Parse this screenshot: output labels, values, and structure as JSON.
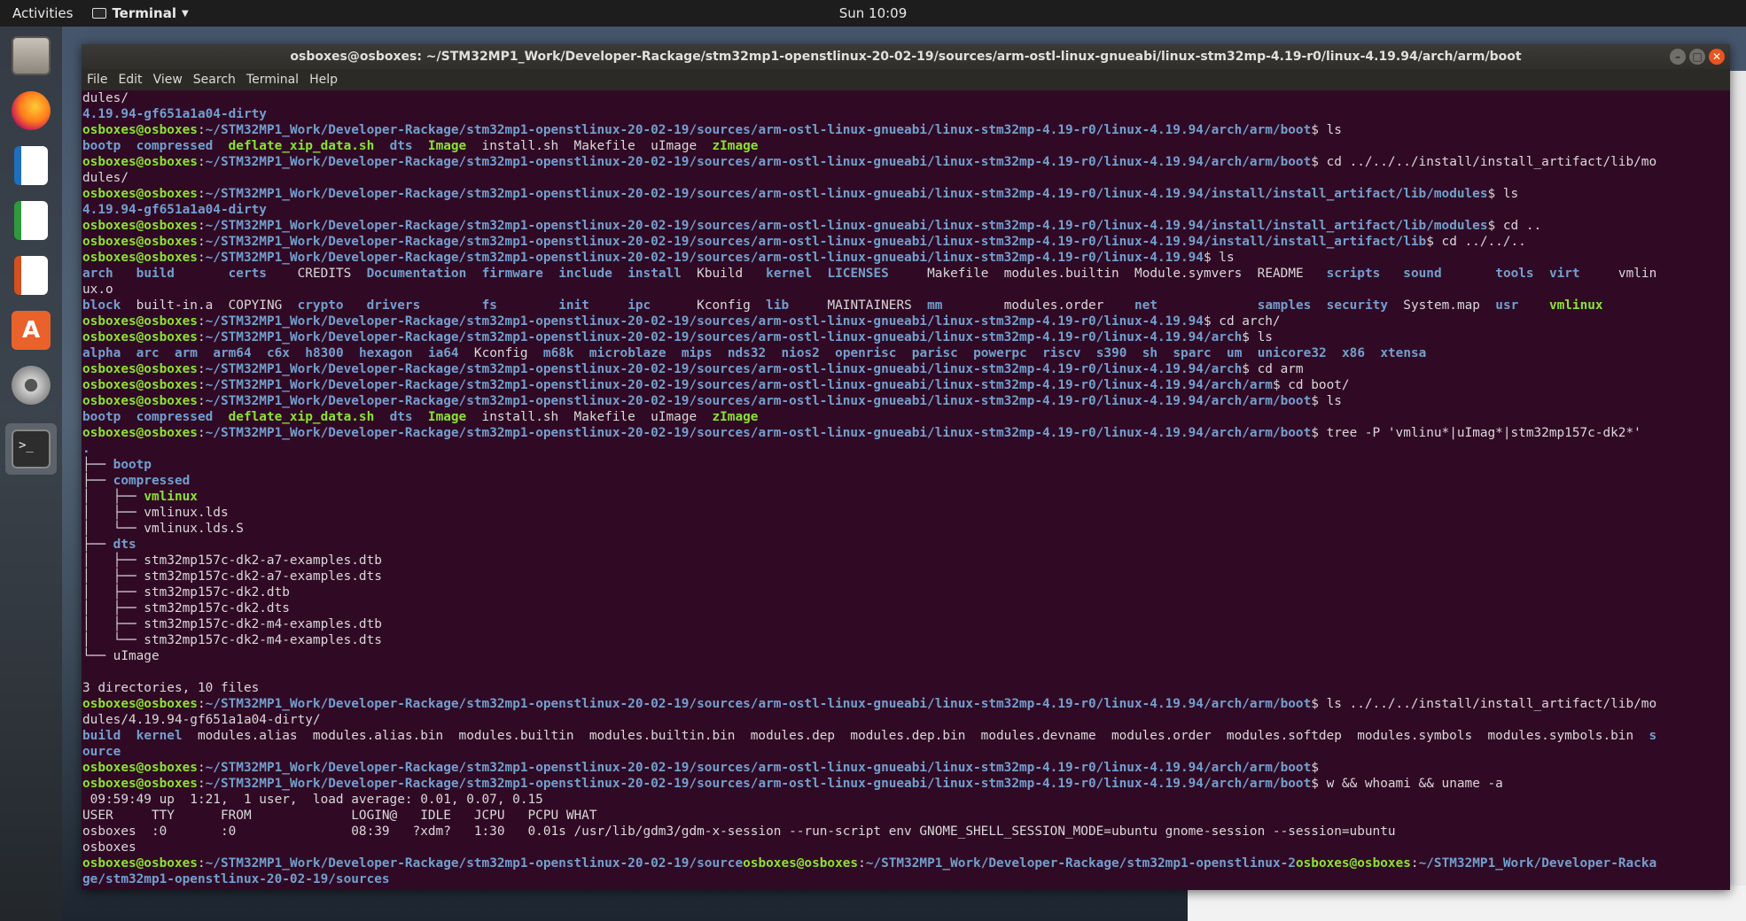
{
  "topbar": {
    "activities": "Activities",
    "app_name": "Terminal",
    "clock": "Sun 10:09"
  },
  "dock": {
    "items": [
      "files-icon",
      "firefox-icon",
      "writer-icon",
      "calc-icon",
      "impress-icon",
      "software-icon",
      "settings-icon",
      "terminal-icon"
    ]
  },
  "window": {
    "title": "osboxes@osboxes: ~/STM32MP1_Work/Developer-Rackage/stm32mp1-openstlinux-20-02-19/sources/arm-ostl-linux-gnueabi/linux-stm32mp-4.19-r0/linux-4.19.94/arch/arm/boot",
    "menu": [
      "File",
      "Edit",
      "View",
      "Search",
      "Terminal",
      "Help"
    ]
  },
  "terminal": {
    "lines": [
      [
        [
          "n",
          "dules/"
        ]
      ],
      [
        [
          "p",
          "4.19.94-gf651a1a04-dirty"
        ]
      ],
      [
        [
          "u",
          "osboxes@osboxes"
        ],
        [
          "n",
          ":"
        ],
        [
          "p",
          "~/STM32MP1_Work/Developer-Rackage/stm32mp1-openstlinux-20-02-19/sources/arm-ostl-linux-gnueabi/linux-stm32mp-4.19-r0/linux-4.19.94/arch/arm/boot"
        ],
        [
          "n",
          "$ ls"
        ]
      ],
      [
        [
          "d",
          "bootp"
        ],
        [
          "n",
          "  "
        ],
        [
          "d",
          "compressed"
        ],
        [
          "n",
          "  "
        ],
        [
          "x",
          "deflate_xip_data.sh"
        ],
        [
          "n",
          "  "
        ],
        [
          "d",
          "dts"
        ],
        [
          "n",
          "  "
        ],
        [
          "x",
          "Image"
        ],
        [
          "n",
          "  install.sh  Makefile  uImage  "
        ],
        [
          "x",
          "zImage"
        ]
      ],
      [
        [
          "u",
          "osboxes@osboxes"
        ],
        [
          "n",
          ":"
        ],
        [
          "p",
          "~/STM32MP1_Work/Developer-Rackage/stm32mp1-openstlinux-20-02-19/sources/arm-ostl-linux-gnueabi/linux-stm32mp-4.19-r0/linux-4.19.94/arch/arm/boot"
        ],
        [
          "n",
          "$ cd ../../../install/install_artifact/lib/mo"
        ]
      ],
      [
        [
          "n",
          "dules/"
        ]
      ],
      [
        [
          "u",
          "osboxes@osboxes"
        ],
        [
          "n",
          ":"
        ],
        [
          "p",
          "~/STM32MP1_Work/Developer-Rackage/stm32mp1-openstlinux-20-02-19/sources/arm-ostl-linux-gnueabi/linux-stm32mp-4.19-r0/linux-4.19.94/install/install_artifact/lib/modules"
        ],
        [
          "n",
          "$ ls"
        ]
      ],
      [
        [
          "p",
          "4.19.94-gf651a1a04-dirty"
        ]
      ],
      [
        [
          "u",
          "osboxes@osboxes"
        ],
        [
          "n",
          ":"
        ],
        [
          "p",
          "~/STM32MP1_Work/Developer-Rackage/stm32mp1-openstlinux-20-02-19/sources/arm-ostl-linux-gnueabi/linux-stm32mp-4.19-r0/linux-4.19.94/install/install_artifact/lib/modules"
        ],
        [
          "n",
          "$ cd .."
        ]
      ],
      [
        [
          "u",
          "osboxes@osboxes"
        ],
        [
          "n",
          ":"
        ],
        [
          "p",
          "~/STM32MP1_Work/Developer-Rackage/stm32mp1-openstlinux-20-02-19/sources/arm-ostl-linux-gnueabi/linux-stm32mp-4.19-r0/linux-4.19.94/install/install_artifact/lib"
        ],
        [
          "n",
          "$ cd ../../.."
        ]
      ],
      [
        [
          "u",
          "osboxes@osboxes"
        ],
        [
          "n",
          ":"
        ],
        [
          "p",
          "~/STM32MP1_Work/Developer-Rackage/stm32mp1-openstlinux-20-02-19/sources/arm-ostl-linux-gnueabi/linux-stm32mp-4.19-r0/linux-4.19.94"
        ],
        [
          "n",
          "$ ls"
        ]
      ],
      [
        [
          "d",
          "arch"
        ],
        [
          "n",
          "   "
        ],
        [
          "d",
          "build"
        ],
        [
          "n",
          "       "
        ],
        [
          "d",
          "certs"
        ],
        [
          "n",
          "    CREDITS  "
        ],
        [
          "d",
          "Documentation"
        ],
        [
          "n",
          "  "
        ],
        [
          "d",
          "firmware"
        ],
        [
          "n",
          "  "
        ],
        [
          "d",
          "include"
        ],
        [
          "n",
          "  "
        ],
        [
          "d",
          "install"
        ],
        [
          "n",
          "  Kbuild   "
        ],
        [
          "d",
          "kernel"
        ],
        [
          "n",
          "  "
        ],
        [
          "d",
          "LICENSES"
        ],
        [
          "n",
          "     Makefile  modules.builtin  Module.symvers  README   "
        ],
        [
          "d",
          "scripts"
        ],
        [
          "n",
          "   "
        ],
        [
          "d",
          "sound"
        ],
        [
          "n",
          "       "
        ],
        [
          "d",
          "tools"
        ],
        [
          "n",
          "  "
        ],
        [
          "d",
          "virt"
        ],
        [
          "n",
          "     vmlin"
        ]
      ],
      [
        [
          "n",
          "ux.o"
        ]
      ],
      [
        [
          "d",
          "block"
        ],
        [
          "n",
          "  built-in.a  COPYING  "
        ],
        [
          "d",
          "crypto"
        ],
        [
          "n",
          "   "
        ],
        [
          "d",
          "drivers"
        ],
        [
          "n",
          "        "
        ],
        [
          "d",
          "fs"
        ],
        [
          "n",
          "        "
        ],
        [
          "d",
          "init"
        ],
        [
          "n",
          "     "
        ],
        [
          "d",
          "ipc"
        ],
        [
          "n",
          "      Kconfig  "
        ],
        [
          "d",
          "lib"
        ],
        [
          "n",
          "     MAINTAINERS  "
        ],
        [
          "d",
          "mm"
        ],
        [
          "n",
          "        modules.order    "
        ],
        [
          "d",
          "net"
        ],
        [
          "n",
          "             "
        ],
        [
          "d",
          "samples"
        ],
        [
          "n",
          "  "
        ],
        [
          "d",
          "security"
        ],
        [
          "n",
          "  System.map  "
        ],
        [
          "d",
          "usr"
        ],
        [
          "n",
          "    "
        ],
        [
          "x",
          "vmlinux"
        ]
      ],
      [
        [
          "u",
          "osboxes@osboxes"
        ],
        [
          "n",
          ":"
        ],
        [
          "p",
          "~/STM32MP1_Work/Developer-Rackage/stm32mp1-openstlinux-20-02-19/sources/arm-ostl-linux-gnueabi/linux-stm32mp-4.19-r0/linux-4.19.94"
        ],
        [
          "n",
          "$ cd arch/"
        ]
      ],
      [
        [
          "u",
          "osboxes@osboxes"
        ],
        [
          "n",
          ":"
        ],
        [
          "p",
          "~/STM32MP1_Work/Developer-Rackage/stm32mp1-openstlinux-20-02-19/sources/arm-ostl-linux-gnueabi/linux-stm32mp-4.19-r0/linux-4.19.94/arch"
        ],
        [
          "n",
          "$ ls"
        ]
      ],
      [
        [
          "d",
          "alpha"
        ],
        [
          "n",
          "  "
        ],
        [
          "d",
          "arc"
        ],
        [
          "n",
          "  "
        ],
        [
          "d",
          "arm"
        ],
        [
          "n",
          "  "
        ],
        [
          "d",
          "arm64"
        ],
        [
          "n",
          "  "
        ],
        [
          "d",
          "c6x"
        ],
        [
          "n",
          "  "
        ],
        [
          "d",
          "h8300"
        ],
        [
          "n",
          "  "
        ],
        [
          "d",
          "hexagon"
        ],
        [
          "n",
          "  "
        ],
        [
          "d",
          "ia64"
        ],
        [
          "n",
          "  Kconfig  "
        ],
        [
          "d",
          "m68k"
        ],
        [
          "n",
          "  "
        ],
        [
          "d",
          "microblaze"
        ],
        [
          "n",
          "  "
        ],
        [
          "d",
          "mips"
        ],
        [
          "n",
          "  "
        ],
        [
          "d",
          "nds32"
        ],
        [
          "n",
          "  "
        ],
        [
          "d",
          "nios2"
        ],
        [
          "n",
          "  "
        ],
        [
          "d",
          "openrisc"
        ],
        [
          "n",
          "  "
        ],
        [
          "d",
          "parisc"
        ],
        [
          "n",
          "  "
        ],
        [
          "d",
          "powerpc"
        ],
        [
          "n",
          "  "
        ],
        [
          "d",
          "riscv"
        ],
        [
          "n",
          "  "
        ],
        [
          "d",
          "s390"
        ],
        [
          "n",
          "  "
        ],
        [
          "d",
          "sh"
        ],
        [
          "n",
          "  "
        ],
        [
          "d",
          "sparc"
        ],
        [
          "n",
          "  "
        ],
        [
          "d",
          "um"
        ],
        [
          "n",
          "  "
        ],
        [
          "d",
          "unicore32"
        ],
        [
          "n",
          "  "
        ],
        [
          "d",
          "x86"
        ],
        [
          "n",
          "  "
        ],
        [
          "d",
          "xtensa"
        ]
      ],
      [
        [
          "u",
          "osboxes@osboxes"
        ],
        [
          "n",
          ":"
        ],
        [
          "p",
          "~/STM32MP1_Work/Developer-Rackage/stm32mp1-openstlinux-20-02-19/sources/arm-ostl-linux-gnueabi/linux-stm32mp-4.19-r0/linux-4.19.94/arch"
        ],
        [
          "n",
          "$ cd arm"
        ]
      ],
      [
        [
          "u",
          "osboxes@osboxes"
        ],
        [
          "n",
          ":"
        ],
        [
          "p",
          "~/STM32MP1_Work/Developer-Rackage/stm32mp1-openstlinux-20-02-19/sources/arm-ostl-linux-gnueabi/linux-stm32mp-4.19-r0/linux-4.19.94/arch/arm"
        ],
        [
          "n",
          "$ cd boot/"
        ]
      ],
      [
        [
          "u",
          "osboxes@osboxes"
        ],
        [
          "n",
          ":"
        ],
        [
          "p",
          "~/STM32MP1_Work/Developer-Rackage/stm32mp1-openstlinux-20-02-19/sources/arm-ostl-linux-gnueabi/linux-stm32mp-4.19-r0/linux-4.19.94/arch/arm/boot"
        ],
        [
          "n",
          "$ ls"
        ]
      ],
      [
        [
          "d",
          "bootp"
        ],
        [
          "n",
          "  "
        ],
        [
          "d",
          "compressed"
        ],
        [
          "n",
          "  "
        ],
        [
          "x",
          "deflate_xip_data.sh"
        ],
        [
          "n",
          "  "
        ],
        [
          "d",
          "dts"
        ],
        [
          "n",
          "  "
        ],
        [
          "x",
          "Image"
        ],
        [
          "n",
          "  install.sh  Makefile  uImage  "
        ],
        [
          "x",
          "zImage"
        ]
      ],
      [
        [
          "u",
          "osboxes@osboxes"
        ],
        [
          "n",
          ":"
        ],
        [
          "p",
          "~/STM32MP1_Work/Developer-Rackage/stm32mp1-openstlinux-20-02-19/sources/arm-ostl-linux-gnueabi/linux-stm32mp-4.19-r0/linux-4.19.94/arch/arm/boot"
        ],
        [
          "n",
          "$ tree -P 'vmlinu*|uImag*|stm32mp157c-dk2*'"
        ]
      ],
      [
        [
          "d",
          "."
        ]
      ],
      [
        [
          "n",
          "├── "
        ],
        [
          "d",
          "bootp"
        ]
      ],
      [
        [
          "n",
          "├── "
        ],
        [
          "d",
          "compressed"
        ]
      ],
      [
        [
          "n",
          "│   ├── "
        ],
        [
          "x",
          "vmlinux"
        ]
      ],
      [
        [
          "n",
          "│   ├── vmlinux.lds"
        ]
      ],
      [
        [
          "n",
          "│   └── vmlinux.lds.S"
        ]
      ],
      [
        [
          "n",
          "├── "
        ],
        [
          "d",
          "dts"
        ]
      ],
      [
        [
          "n",
          "│   ├── stm32mp157c-dk2-a7-examples.dtb"
        ]
      ],
      [
        [
          "n",
          "│   ├── stm32mp157c-dk2-a7-examples.dts"
        ]
      ],
      [
        [
          "n",
          "│   ├── stm32mp157c-dk2.dtb"
        ]
      ],
      [
        [
          "n",
          "│   ├── stm32mp157c-dk2.dts"
        ]
      ],
      [
        [
          "n",
          "│   ├── stm32mp157c-dk2-m4-examples.dtb"
        ]
      ],
      [
        [
          "n",
          "│   └── stm32mp157c-dk2-m4-examples.dts"
        ]
      ],
      [
        [
          "n",
          "└── uImage"
        ]
      ],
      [
        [
          "n",
          ""
        ]
      ],
      [
        [
          "n",
          "3 directories, 10 files"
        ]
      ],
      [
        [
          "u",
          "osboxes@osboxes"
        ],
        [
          "n",
          ":"
        ],
        [
          "p",
          "~/STM32MP1_Work/Developer-Rackage/stm32mp1-openstlinux-20-02-19/sources/arm-ostl-linux-gnueabi/linux-stm32mp-4.19-r0/linux-4.19.94/arch/arm/boot"
        ],
        [
          "n",
          "$ ls ../../../install/install_artifact/lib/mo"
        ]
      ],
      [
        [
          "n",
          "dules/4.19.94-gf651a1a04-dirty/"
        ]
      ],
      [
        [
          "d",
          "build"
        ],
        [
          "n",
          "  "
        ],
        [
          "d",
          "kernel"
        ],
        [
          "n",
          "  modules.alias  modules.alias.bin  modules.builtin  modules.builtin.bin  modules.dep  modules.dep.bin  modules.devname  modules.order  modules.softdep  modules.symbols  modules.symbols.bin  "
        ],
        [
          "d",
          "s"
        ]
      ],
      [
        [
          "d",
          "ource"
        ]
      ],
      [
        [
          "u",
          "osboxes@osboxes"
        ],
        [
          "n",
          ":"
        ],
        [
          "p",
          "~/STM32MP1_Work/Developer-Rackage/stm32mp1-openstlinux-20-02-19/sources/arm-ostl-linux-gnueabi/linux-stm32mp-4.19-r0/linux-4.19.94/arch/arm/boot"
        ],
        [
          "n",
          "$"
        ]
      ],
      [
        [
          "u",
          "osboxes@osboxes"
        ],
        [
          "n",
          ":"
        ],
        [
          "p",
          "~/STM32MP1_Work/Developer-Rackage/stm32mp1-openstlinux-20-02-19/sources/arm-ostl-linux-gnueabi/linux-stm32mp-4.19-r0/linux-4.19.94/arch/arm/boot"
        ],
        [
          "n",
          "$ w && whoami && uname -a"
        ]
      ],
      [
        [
          "n",
          " 09:59:49 up  1:21,  1 user,  load average: 0.01, 0.07, 0.15"
        ]
      ],
      [
        [
          "n",
          "USER     TTY      FROM             LOGIN@   IDLE   JCPU   PCPU WHAT"
        ]
      ],
      [
        [
          "n",
          "osboxes  :0       :0               08:39   ?xdm?   1:30   0.01s /usr/lib/gdm3/gdm-x-session --run-script env GNOME_SHELL_SESSION_MODE=ubuntu gnome-session --session=ubuntu"
        ]
      ],
      [
        [
          "n",
          "osboxes"
        ]
      ],
      [
        [
          "u",
          "osboxes@osboxes"
        ],
        [
          "n",
          ":"
        ],
        [
          "p",
          "~/STM32MP1_Work/Developer-Rackage/stm32mp1-openstlinux-20-02-19/source"
        ],
        [
          "u",
          "osboxes@osboxes"
        ],
        [
          "n",
          ":"
        ],
        [
          "p",
          "~/STM32MP1_Work/Developer-Rackage/stm32mp1-openstlinux-2"
        ],
        [
          "u",
          "osboxes@osboxes"
        ],
        [
          "n",
          ":"
        ],
        [
          "p",
          "~/STM32MP1_Work/Developer-Racka"
        ]
      ],
      [
        [
          "p",
          "ge/stm32mp1-openstlinux-20-02-19/sources"
        ]
      ]
    ]
  }
}
